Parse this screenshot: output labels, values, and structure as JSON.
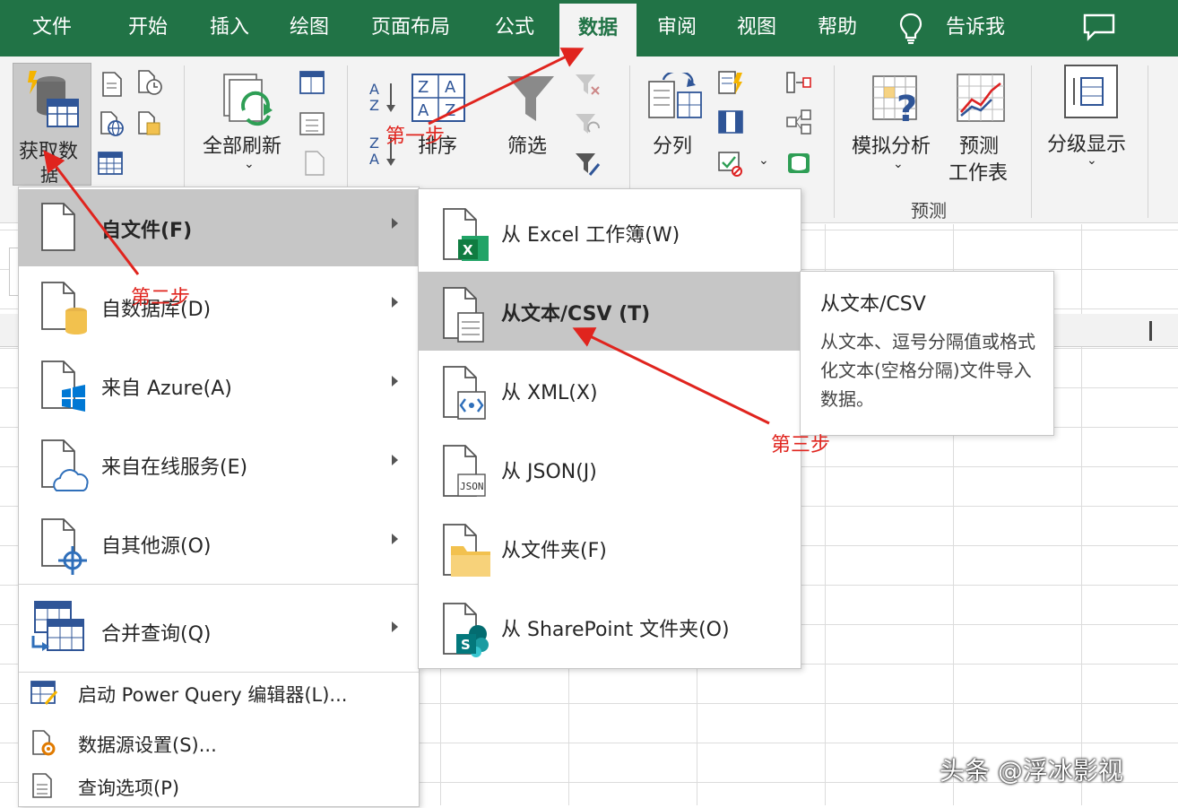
{
  "tabs": {
    "file": "文件",
    "home": "开始",
    "insert": "插入",
    "draw": "绘图",
    "layout": "页面布局",
    "formulas": "公式",
    "data": "数据",
    "review": "审阅",
    "view": "视图",
    "help": "帮助",
    "tellme": "告诉我"
  },
  "ribbon": {
    "get_data_line1": "获取数",
    "get_data_line2": "据",
    "refresh_all": "全部刷新",
    "sort": "排序",
    "filter": "筛选",
    "split": "分列",
    "whatif": "模拟分析",
    "forecast_line1": "预测",
    "forecast_line2": "工作表",
    "outline": "分级显示",
    "forecast_group": "预测"
  },
  "menu": {
    "from_file": "自文件(F)",
    "from_database": "自数据库(D)",
    "from_azure": "来自 Azure(A)",
    "from_online": "来自在线服务(E)",
    "from_other": "自其他源(O)",
    "combine": "合并查询(Q)",
    "launch_pq": "启动 Power Query 编辑器(L)...",
    "datasource": "数据源设置(S)...",
    "query_options": "查询选项(P)"
  },
  "submenu": {
    "excel": "从 Excel 工作簿(W)",
    "text_csv": "从文本/CSV (T)",
    "xml": "从 XML(X)",
    "json": "从 JSON(J)",
    "folder": "从文件夹(F)",
    "sharepoint": "从 SharePoint 文件夹(O)"
  },
  "tooltip": {
    "title": "从文本/CSV",
    "body": "从文本、逗号分隔值或格式化文本(空格分隔)文件导入数据。"
  },
  "annotations": {
    "step1": "第一步",
    "step2": "第二步",
    "step3": "第三步"
  },
  "watermark": "头条 @浮冰影视",
  "colors": {
    "excel_green": "#217346",
    "annotation_red": "#e0241e",
    "menu_highlight": "#c6c6c6"
  },
  "icons": {
    "tellme": "lightbulb-icon",
    "comment": "comment-icon",
    "get_data": "database-icon",
    "refresh": "refresh-icon",
    "sort": "sort-icon",
    "filter": "funnel-icon"
  }
}
